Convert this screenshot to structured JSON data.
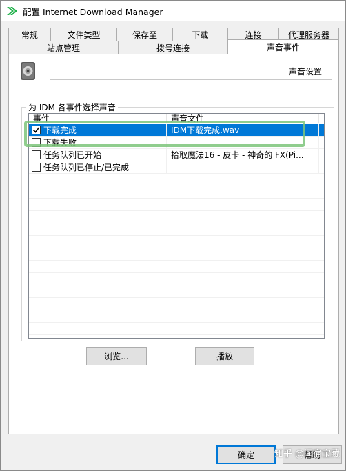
{
  "window": {
    "title": "配置 Internet Download Manager"
  },
  "tabs_row1": [
    "常规",
    "文件类型",
    "保存至",
    "下载",
    "连接",
    "代理服务器"
  ],
  "tabs_row2": [
    "站点管理",
    "拨号连接",
    "声音事件"
  ],
  "active_tab": "声音事件",
  "page": {
    "section_title": "声音设置",
    "group_label": "为 IDM 各事件选择声音",
    "columns": [
      "事件",
      "声音文件"
    ],
    "rows": [
      {
        "checked": true,
        "event": "下载完成",
        "sound": "IDM下载完成.wav",
        "selected": true
      },
      {
        "checked": false,
        "event": "下载失败",
        "sound": "",
        "selected": false
      },
      {
        "checked": false,
        "event": "任务队列已开始",
        "sound": "拾取魔法16 - 皮卡 - 神奇的 FX(Pi...",
        "selected": false
      },
      {
        "checked": false,
        "event": "任务队列已停止/已完成",
        "sound": "",
        "selected": false
      }
    ],
    "browse_label": "浏览...",
    "play_label": "播放"
  },
  "footer": {
    "ok_label": "确定",
    "help_label": "帮助"
  },
  "watermark": "知乎 @间宿宝藏",
  "colors": {
    "selection": "#0078d7",
    "highlight": "#7cc47a",
    "app_icon": "#22b14c"
  }
}
